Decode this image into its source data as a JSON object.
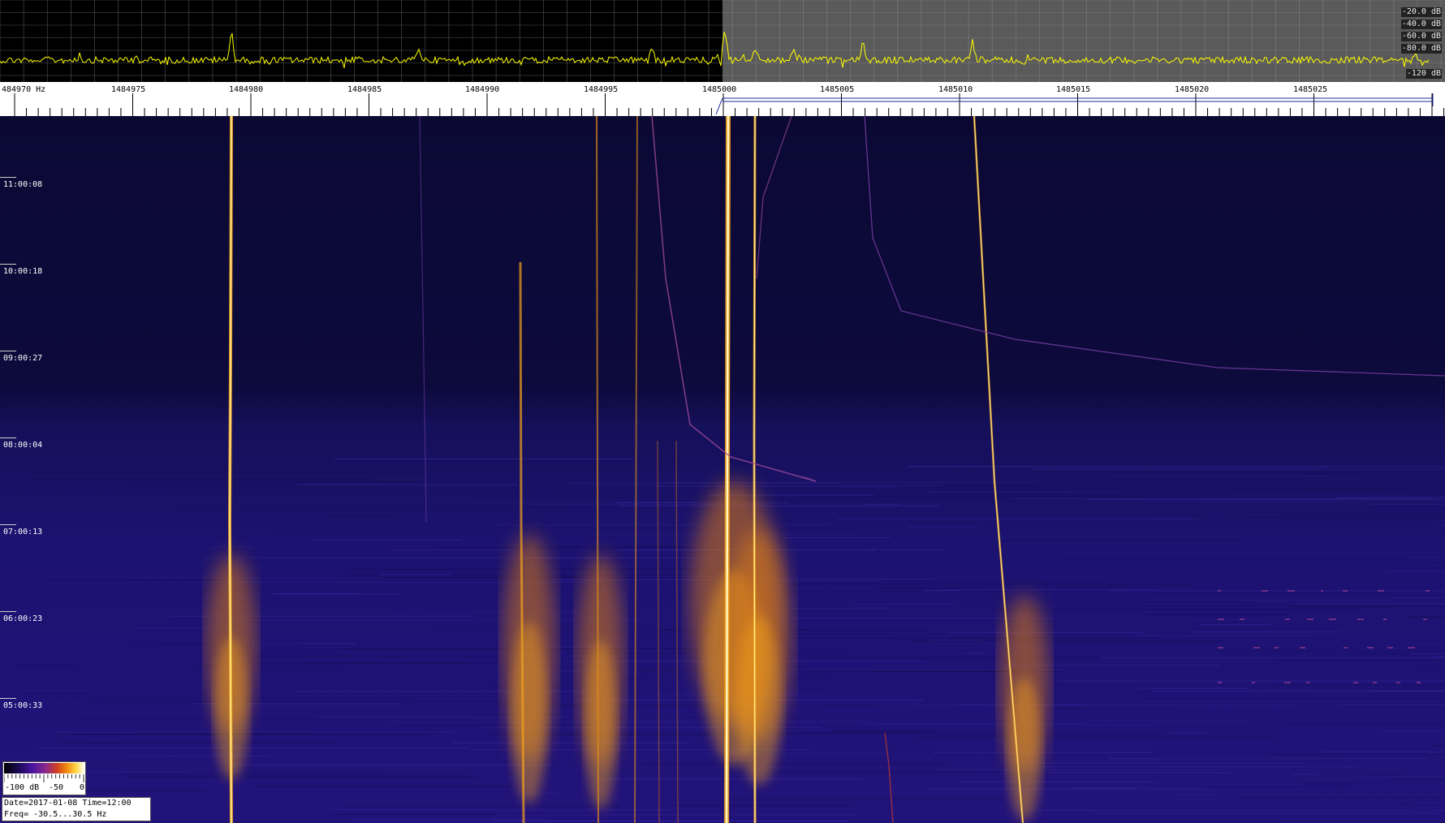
{
  "spectrum": {
    "db_labels": [
      "-20.0 dB",
      "-40.0 dB",
      "-60.0 dB",
      "-80.0 dB",
      "-120 dB"
    ],
    "trace_color": "#ffff00",
    "left_bg": "#000000",
    "right_bg": "#555555"
  },
  "ruler": {
    "freq_labels": [
      "484970 Hz",
      "1484975",
      "1484980",
      "1484985",
      "1484990",
      "1484995",
      "1485000",
      "1485005",
      "1485010",
      "1485015",
      "1485020",
      "1485025"
    ],
    "marker_color": "#1e2a9a"
  },
  "waterfall": {
    "time_labels": [
      "11:00:08",
      "10:00:18",
      "09:00:27",
      "08:00:04",
      "07:00:13",
      "06:00:23",
      "05:00:33"
    ],
    "bg_top": "#0b0934",
    "bg_bottom": "#1c1070",
    "signal_core": "#fff2a0",
    "signal_glow": "#f2a21c"
  },
  "colorbar": {
    "labels": [
      "-100 dB",
      "-50",
      "0"
    ]
  },
  "info": {
    "line1": "Date=2017-01-08 Time=12:00",
    "line2": "Freq= -30.5...30.5 Hz"
  }
}
